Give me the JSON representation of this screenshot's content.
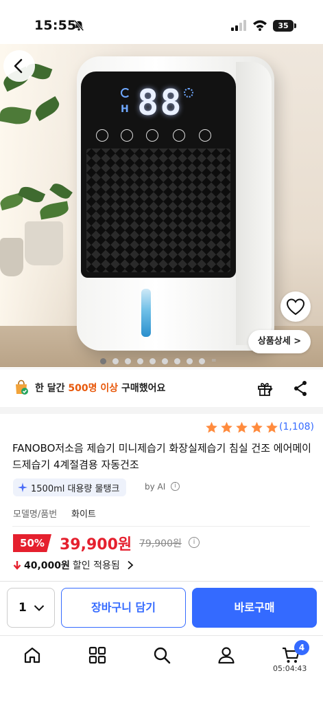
{
  "status_bar": {
    "time": "15:55",
    "battery": "35"
  },
  "hero": {
    "display_digits": "88",
    "display_letter": "H",
    "detail_button": "상품상세 >",
    "slide_count": 9,
    "active_slide": 1
  },
  "purchase_banner": {
    "prefix": "한 달간 ",
    "highlight": "500명 이상",
    "suffix": " 구매했어요"
  },
  "rating": {
    "stars": 5,
    "review_count": "(1,108)"
  },
  "product": {
    "title": "FANOBO저소음 제습기 미니제습기 화장실제습기 침실 건조 에어메이드제습기 4계절겸용 자동건조",
    "ai_chip": "1500ml 대용량 물탱크",
    "by_ai": "by AI",
    "info_glyph": "i",
    "model_label": "모델명/품번",
    "model_value": "화이트"
  },
  "price": {
    "discount": "50%",
    "sale": "39,900원",
    "original": "79,900원",
    "coupon_amount": "40,000원",
    "coupon_text": "할인 적용됨"
  },
  "actions": {
    "quantity": "1",
    "cart_label": "장바구니 담기",
    "buy_label": "바로구매"
  },
  "bottom_nav": {
    "items": [
      "home-icon",
      "category-icon",
      "search-icon",
      "profile-icon",
      "cart-icon"
    ],
    "cart_badge": "4",
    "clock": "05:04:43"
  },
  "colors": {
    "accent_blue": "#346aff",
    "price_red": "#e5202e",
    "highlight_orange": "#e8590c",
    "star_orange": "#ff8b3d"
  }
}
